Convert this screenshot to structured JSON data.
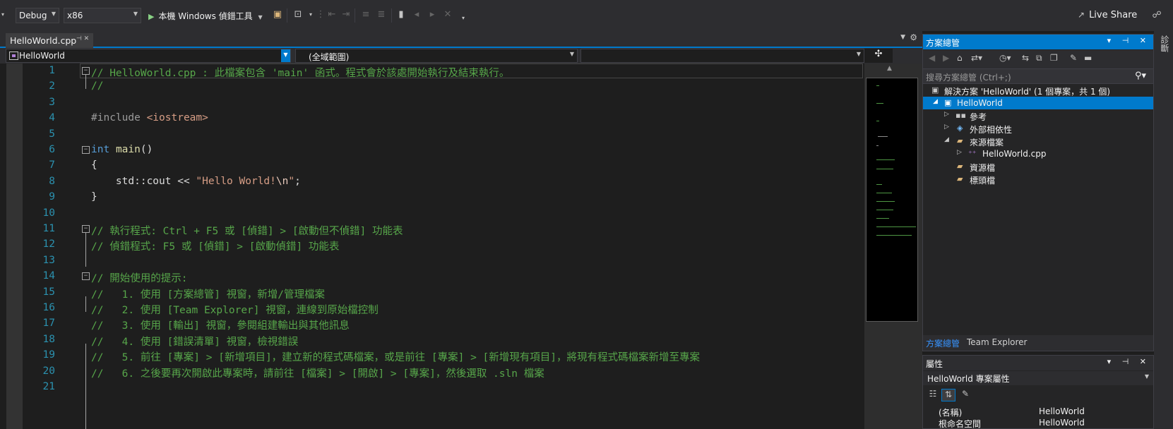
{
  "toolbar": {
    "config": "Debug",
    "platform": "x86",
    "run_label": "本機 Windows 偵錯工具",
    "live_share": "Live Share"
  },
  "tab": {
    "filename": "HelloWorld.cpp"
  },
  "navbar": {
    "project": "HelloWorld",
    "scope": "(全域範圍)",
    "member": ""
  },
  "editor": {
    "lines": [
      {
        "n": "1",
        "text": "// HelloWorld.cpp : 此檔案包含 'main' 函式。程式會於該處開始執行及結束執行。"
      },
      {
        "n": "2",
        "text": "//"
      },
      {
        "n": "3",
        "text": ""
      },
      {
        "n": "4",
        "pre": "#include ",
        "inc": "<iostream>"
      },
      {
        "n": "5",
        "text": ""
      },
      {
        "n": "6",
        "kw": "int",
        "fn": "main",
        "rest": "()"
      },
      {
        "n": "7",
        "text": "{"
      },
      {
        "n": "8",
        "pre": "    std::cout << ",
        "str1": "\"Hello World!",
        "esc": "\\n",
        "str2": "\"",
        "end": ";"
      },
      {
        "n": "9",
        "text": "}"
      },
      {
        "n": "10",
        "text": ""
      },
      {
        "n": "11",
        "text": "// 執行程式: Ctrl + F5 或 [偵錯] > [啟動但不偵錯] 功能表"
      },
      {
        "n": "12",
        "text": "// 偵錯程式: F5 或 [偵錯] > [啟動偵錯] 功能表"
      },
      {
        "n": "13",
        "text": ""
      },
      {
        "n": "14",
        "text": "// 開始使用的提示: "
      },
      {
        "n": "15",
        "text": "//   1. 使用 [方案總管] 視窗，新增/管理檔案"
      },
      {
        "n": "16",
        "text": "//   2. 使用 [Team Explorer] 視窗，連線到原始檔控制"
      },
      {
        "n": "17",
        "text": "//   3. 使用 [輸出] 視窗，參閱組建輸出與其他訊息"
      },
      {
        "n": "18",
        "text": "//   4. 使用 [錯誤清單] 視窗，檢視錯誤"
      },
      {
        "n": "19",
        "text": "//   5. 前往 [專案] > [新增項目]，建立新的程式碼檔案，或是前往 [專案] > [新增現有項目]，將現有程式碼檔案新增至專案"
      },
      {
        "n": "20",
        "text": "//   6. 之後要再次開啟此專案時，請前往 [檔案] > [開啟] > [專案]，然後選取 .sln 檔案"
      },
      {
        "n": "21",
        "text": ""
      }
    ]
  },
  "solution_explorer": {
    "title": "方案總管",
    "search_placeholder": "搜尋方案總管 (Ctrl+;)",
    "solution": "解決方案 'HelloWorld' (1 個專案，共 1 個)",
    "project": "HelloWorld",
    "references": "參考",
    "external_deps": "外部相依性",
    "source_files": "來源檔案",
    "cpp_file": "HelloWorld.cpp",
    "resource_files": "資源檔",
    "header_files": "標頭檔",
    "tab_solution": "方案總管",
    "tab_team": "Team Explorer"
  },
  "properties": {
    "title": "屬性",
    "object": "HelloWorld  專案屬性",
    "rows": [
      {
        "k": "(名稱)",
        "v": "HelloWorld"
      },
      {
        "k": "根命名空間",
        "v": "HelloWorld"
      }
    ]
  },
  "right_strip": {
    "label": "診斷"
  }
}
